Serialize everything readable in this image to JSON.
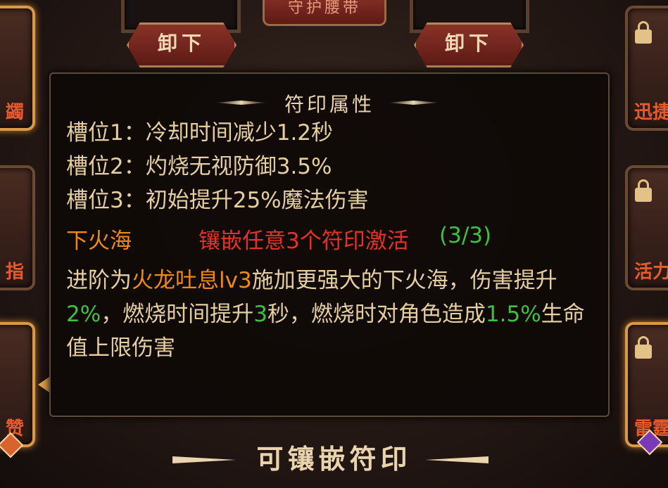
{
  "top_slots": {
    "left_button": "卸下",
    "center_label": "守护腰带",
    "right_button": "卸下"
  },
  "side_slots": {
    "left": [
      {
        "label": "蠲"
      },
      {
        "label": "指"
      },
      {
        "label": "赞"
      }
    ],
    "right": [
      {
        "label": "迅捷"
      },
      {
        "label": "活力"
      },
      {
        "label": "雷霆"
      }
    ]
  },
  "tooltip": {
    "title": "符印属性",
    "slots": [
      "槽位1：冷却时间减少1.2秒",
      "槽位2：灼烧无视防御3.5%",
      "槽位3：初始提升25%魔法伤害"
    ],
    "set_name": "下火海",
    "set_condition": "镶嵌任意3个符印激活",
    "set_count": "(3/3)",
    "desc": {
      "p1": "进阶为",
      "skill": "火龙吐息lv3",
      "p2": "施加更强大的下火海，伤害提升",
      "v1": "2%",
      "p3": "，燃烧时间提升",
      "v2": "3",
      "p4": "秒，燃烧时对角色造成",
      "v3": "1.5%",
      "p5": "生命值上限伤害"
    }
  },
  "bottom": {
    "title": "可镶嵌符印"
  },
  "colors": {
    "gold_text": "#e5ce9f",
    "orange": "#ee8a14",
    "red": "#e03226",
    "green": "#3ec13e"
  }
}
